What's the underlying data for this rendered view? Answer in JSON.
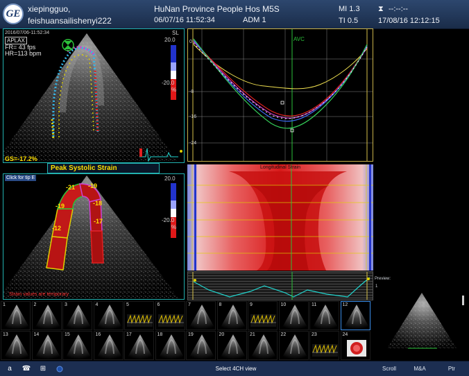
{
  "header": {
    "patient_name": "xiepingguo,",
    "patient_id": "feishuansailishenyi222",
    "hospital": "HuNan Province People Hos M5S",
    "datetime": "06/07/16 11:52:34",
    "adm": "ADM 1",
    "mi": "MI 1.3",
    "ti": "TI 0.5",
    "timer": "--:--:--",
    "timer_icon": "hourglass-icon",
    "system_date": "17/08/16 12:12:15",
    "logo_text": "GE"
  },
  "top_panel": {
    "timestamp": "2016/07/06-11:52:34",
    "view": "APLAX",
    "frame_rate": "FR= 43 fps",
    "heart_rate": "HR=113 bpm",
    "scale_unit": "SL",
    "scale_max": "20.0",
    "scale_min": "-20.0",
    "scale_pct": "%",
    "global_strain": "GS=-17.2%"
  },
  "peak_label": "Peak Systolic Strain",
  "bottom_panel": {
    "click_tip": "Click for tip E",
    "scale_max": "20.0",
    "scale_min": "-20.0",
    "scale_pct": "%",
    "segment_values": [
      "-12",
      "-19",
      "-21",
      "-19",
      "-18",
      "-17"
    ],
    "temporary_note": "Strain values are temporary"
  },
  "strain_curve": {
    "avc_label": "AVC",
    "y_ticks": [
      "0",
      "-8",
      "-16",
      "-24"
    ]
  },
  "strain_map": {
    "title": "Longitudinal Strain"
  },
  "preview": {
    "title": "Preview:",
    "number": "1"
  },
  "thumbnails": [
    {
      "n": "1",
      "kind": "echo"
    },
    {
      "n": "2",
      "kind": "echo"
    },
    {
      "n": "3",
      "kind": "echo"
    },
    {
      "n": "4",
      "kind": "echo"
    },
    {
      "n": "5",
      "kind": "doppler"
    },
    {
      "n": "6",
      "kind": "doppler"
    },
    {
      "n": "7",
      "kind": "echo"
    },
    {
      "n": "8",
      "kind": "echo"
    },
    {
      "n": "9",
      "kind": "doppler"
    },
    {
      "n": "10",
      "kind": "echo"
    },
    {
      "n": "11",
      "kind": "echo"
    },
    {
      "n": "12",
      "kind": "echo"
    },
    {
      "n": "13",
      "kind": "echo"
    },
    {
      "n": "14",
      "kind": "echo"
    },
    {
      "n": "15",
      "kind": "echo"
    },
    {
      "n": "16",
      "kind": "echo"
    },
    {
      "n": "17",
      "kind": "echo"
    },
    {
      "n": "18",
      "kind": "echo"
    },
    {
      "n": "19",
      "kind": "echo"
    },
    {
      "n": "20",
      "kind": "echo"
    },
    {
      "n": "21",
      "kind": "echo"
    },
    {
      "n": "22",
      "kind": "echo"
    },
    {
      "n": "23",
      "kind": "doppler"
    },
    {
      "n": "24",
      "kind": "bullseye"
    }
  ],
  "selected_thumbnail": "12",
  "statusbar": {
    "icons": [
      "keyboard-icon",
      "phone-icon",
      "network-icon",
      "record-icon"
    ],
    "keyboard_glyph": "a",
    "status": "Select 4CH view",
    "buttons": [
      "Scroll",
      "M&A",
      "Ptr"
    ]
  },
  "colors": {
    "accent": "#22b2b0",
    "highlight": "#ffe000",
    "header_bg": "#22395e",
    "status_bg": "#1c2e51",
    "selected_border": "#3b8eea"
  }
}
